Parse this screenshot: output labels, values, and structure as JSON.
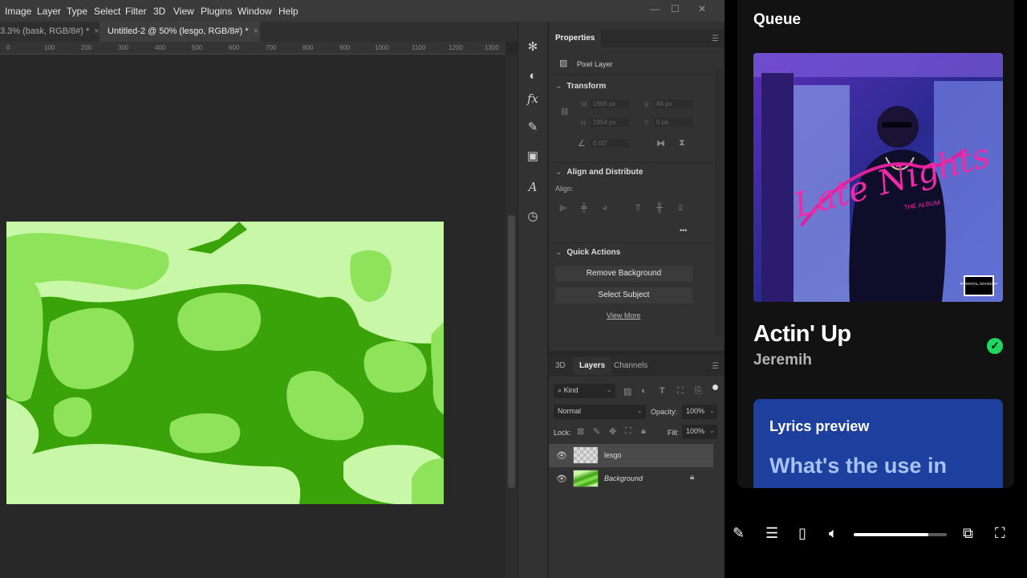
{
  "photoshop": {
    "menu": [
      "Image",
      "Layer",
      "Type",
      "Select",
      "Filter",
      "3D",
      "View",
      "Plugins",
      "Window",
      "Help"
    ],
    "doc_tabs": [
      {
        "label": "3.3% (bask, RGB/8#) *",
        "close": "×"
      },
      {
        "label": "Untitled-2 @ 50% (lesgo, RGB/8#) *",
        "close": "×"
      }
    ],
    "ruler_ticks": [
      "0",
      "100",
      "200",
      "300",
      "400",
      "500",
      "600",
      "700",
      "800",
      "900",
      "1000",
      "1100",
      "1200",
      "1300"
    ],
    "properties": {
      "tab": "Properties",
      "layer_kind": "Pixel Layer",
      "transform": {
        "title": "Transform",
        "w_label": "W",
        "w_value": "1905 px",
        "h_label": "H",
        "h_value": "1954 px",
        "x_label": "X",
        "x_value": "84 px",
        "y_label": "Y",
        "y_value": "0 px",
        "angle_value": "0.00°"
      },
      "align": {
        "title": "Align and Distribute",
        "align_label": "Align:",
        "more": "•••"
      },
      "quick_actions": {
        "title": "Quick Actions",
        "remove_bg": "Remove Background",
        "select_subject": "Select Subject",
        "view_more": "View More"
      }
    },
    "layers_panel": {
      "tabs": [
        "3D",
        "Layers",
        "Channels"
      ],
      "filter_kind": "Kind",
      "blend_mode": "Normal",
      "opacity_label": "Opacity:",
      "opacity_value": "100%",
      "lock_label": "Lock:",
      "fill_label": "Fill:",
      "fill_value": "100%",
      "layers": [
        {
          "name": "lesgo",
          "selected": true
        },
        {
          "name": "Background",
          "selected": false
        }
      ]
    }
  },
  "spotify": {
    "queue_title": "Queue",
    "track_title": "Actin' Up",
    "artist": "Jeremih",
    "album_art_text": "Late Nights",
    "album_art_subtext": "THE ALBUM",
    "parental_advisory": "PARENTAL ADVISORY",
    "lyrics_heading": "Lyrics preview",
    "lyrics_line": "What's the use in",
    "volume_level": 0.8,
    "colors": {
      "accent_green": "#1ed760",
      "lyrics_card": "#1d3f9e"
    }
  }
}
